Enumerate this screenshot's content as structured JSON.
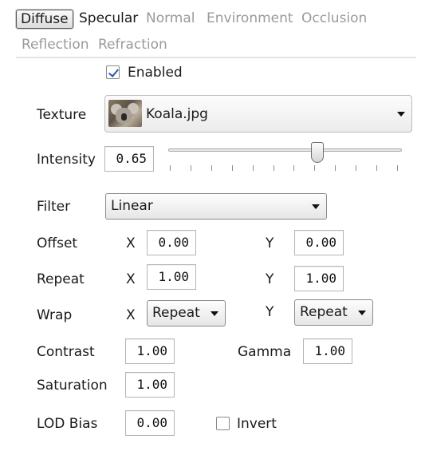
{
  "tabs": [
    {
      "label": "Diffuse",
      "state": "active"
    },
    {
      "label": "Specular",
      "state": "dark"
    },
    {
      "label": "Normal",
      "state": "disabled"
    },
    {
      "label": "Environment",
      "state": "disabled"
    },
    {
      "label": "Occlusion",
      "state": "disabled"
    },
    {
      "label": "Reflection",
      "state": "disabled"
    },
    {
      "label": "Refraction",
      "state": "disabled"
    }
  ],
  "enabled": {
    "label": "Enabled",
    "checked": true
  },
  "texture": {
    "label": "Texture",
    "file": "Koala.jpg",
    "thumbnail_icon": "koala-thumbnail"
  },
  "intensity": {
    "label": "Intensity",
    "value": "0.65",
    "slider_fraction": 0.65
  },
  "filter": {
    "label": "Filter",
    "value": "Linear"
  },
  "offset": {
    "label": "Offset",
    "x_label": "X",
    "x": "0.00",
    "y_label": "Y",
    "y": "0.00"
  },
  "repeat": {
    "label": "Repeat",
    "x_label": "X",
    "x": "1.00",
    "y_label": "Y",
    "y": "1.00"
  },
  "wrap": {
    "label": "Wrap",
    "x_label": "X",
    "x": "Repeat",
    "y_label": "Y",
    "y": "Repeat"
  },
  "contrast": {
    "label": "Contrast",
    "value": "1.00"
  },
  "gamma": {
    "label": "Gamma",
    "value": "1.00"
  },
  "saturation": {
    "label": "Saturation",
    "value": "1.00"
  },
  "lod_bias": {
    "label": "LOD Bias",
    "value": "0.00"
  },
  "invert": {
    "label": "Invert",
    "checked": false
  },
  "colors": {
    "check_mark": "#2a55b5",
    "disabled_text": "#9a9a9a"
  }
}
